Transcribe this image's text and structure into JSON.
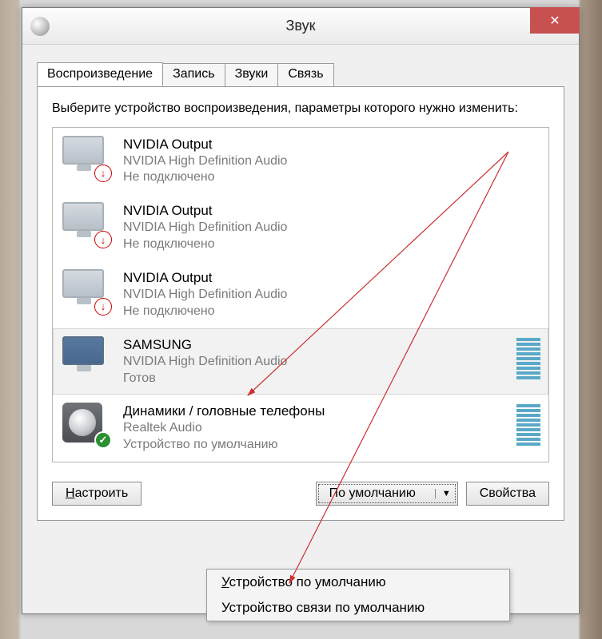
{
  "window": {
    "title": "Звук"
  },
  "tabs": {
    "playback": "Воспроизведение",
    "recording": "Запись",
    "sounds": "Звуки",
    "comm": "Связь"
  },
  "instructions": "Выберите устройство воспроизведения, параметры которого нужно изменить:",
  "devices": [
    {
      "name": "NVIDIA Output",
      "driver": "NVIDIA High Definition Audio",
      "status": "Не подключено",
      "icon": "monitor",
      "badge": "down",
      "level": false
    },
    {
      "name": "NVIDIA Output",
      "driver": "NVIDIA High Definition Audio",
      "status": "Не подключено",
      "icon": "monitor",
      "badge": "down",
      "level": false
    },
    {
      "name": "NVIDIA Output",
      "driver": "NVIDIA High Definition Audio",
      "status": "Не подключено",
      "icon": "monitor",
      "badge": "down",
      "level": false
    },
    {
      "name": "SAMSUNG",
      "driver": "NVIDIA High Definition Audio",
      "status": "Готов",
      "icon": "monitor-active",
      "badge": "",
      "level": true,
      "selected": true
    },
    {
      "name": "Динамики / головные телефоны",
      "driver": "Realtek Audio",
      "status": "Устройство по умолчанию",
      "icon": "speaker",
      "badge": "ok",
      "level": true
    }
  ],
  "buttons": {
    "configure": "Настроить",
    "default": "По умолчанию",
    "properties": "Свойства"
  },
  "dropdown": {
    "item1": "Устройство по умолчанию",
    "item2": "Устройство связи по умолчанию"
  }
}
